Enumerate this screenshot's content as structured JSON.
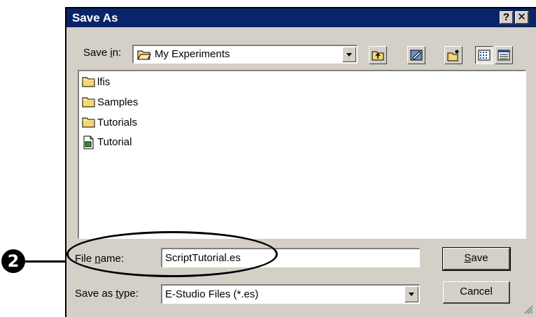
{
  "window": {
    "title": "Save As",
    "help_button": "?",
    "close_button": "✕"
  },
  "save_in": {
    "label_prefix": "Save ",
    "label_accel": "i",
    "label_suffix": "n:",
    "value": "My Experiments"
  },
  "toolbar": {
    "buttons": [
      "up-one-level",
      "desktop",
      "create-new-folder",
      "list-view",
      "details-view"
    ]
  },
  "files": [
    {
      "name": "lfis",
      "type": "folder"
    },
    {
      "name": "Samples",
      "type": "folder"
    },
    {
      "name": "Tutorials",
      "type": "folder"
    },
    {
      "name": "Tutorial",
      "type": "document"
    }
  ],
  "file_name": {
    "label_prefix": "File ",
    "label_accel": "n",
    "label_suffix": "ame:",
    "value": "ScriptTutorial.es"
  },
  "save_as_type": {
    "label_prefix": "Save as ",
    "label_accel": "t",
    "label_suffix": "ype:",
    "value": "E-Studio Files (*.es)"
  },
  "buttons": {
    "save_accel": "S",
    "save_rest": "ave",
    "cancel": "Cancel"
  },
  "callout": {
    "number": "2"
  },
  "colors": {
    "titlebar": "#0a246a",
    "dialog_face": "#d4d0c8",
    "folder_yellow": "#f7d774"
  }
}
